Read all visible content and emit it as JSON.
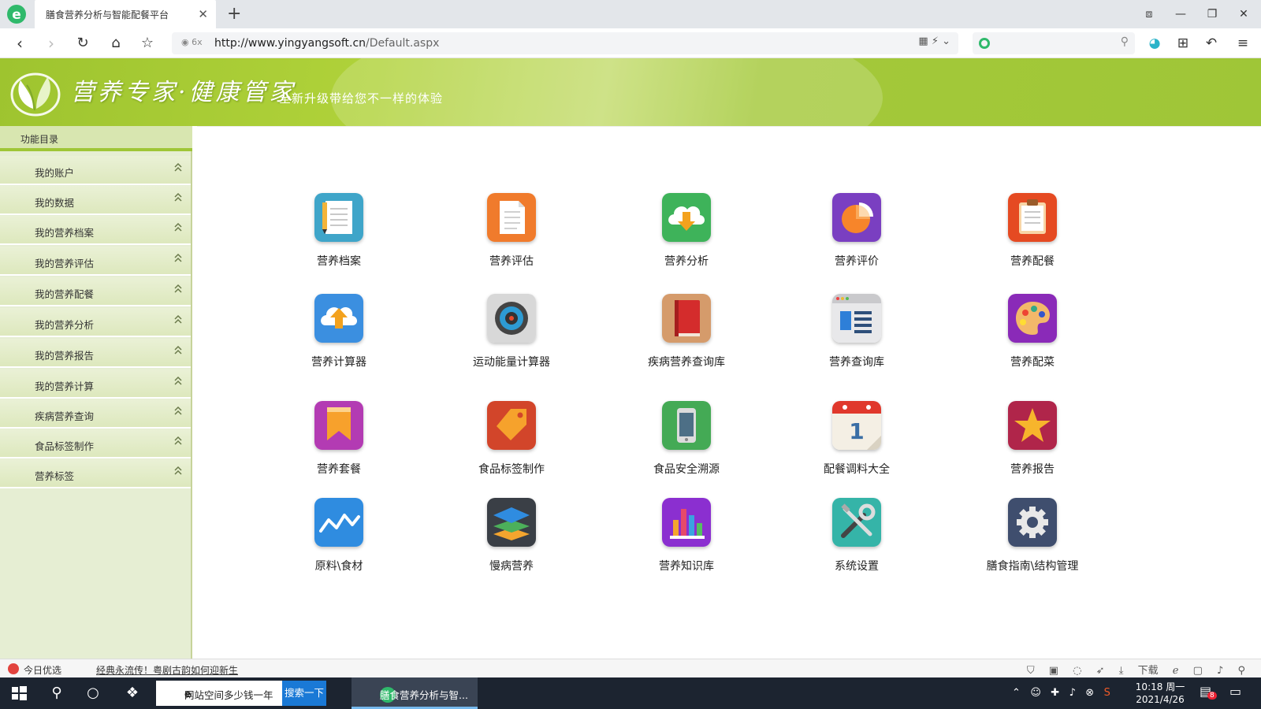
{
  "browser": {
    "tab_title": "膳食营养分析与智能配餐平台",
    "tab_close": "✕",
    "new_tab": "+",
    "url_host": "http://www.yingyangsoft.cn",
    "url_path": "/Default.aspx",
    "addr_left_icons": "◉ 6x",
    "addr_right_icons": "▦  ⚡  ⌄",
    "search_mag": "⚲"
  },
  "header": {
    "slogan": "营养专家·健康管家",
    "subslogan": "全新升级带给您不一样的体验",
    "colors": {
      "green": "#9fc637",
      "light_green": "#e6eed3"
    }
  },
  "sidebar": {
    "title": "功能目录",
    "items": [
      {
        "label": "我的账户"
      },
      {
        "label": "我的数据"
      },
      {
        "label": "我的营养档案"
      },
      {
        "label": "我的营养评估"
      },
      {
        "label": "我的营养配餐"
      },
      {
        "label": "我的营养分析"
      },
      {
        "label": "我的营养报告"
      },
      {
        "label": "我的营养计算"
      },
      {
        "label": "疾病营养查询"
      },
      {
        "label": "食品标签制作"
      },
      {
        "label": "营养标签"
      }
    ]
  },
  "apps": [
    {
      "label": "营养档案",
      "icon": "notepad-pencil-icon"
    },
    {
      "label": "营养评估",
      "icon": "document-icon"
    },
    {
      "label": "营养分析",
      "icon": "cloud-download-icon"
    },
    {
      "label": "营养评价",
      "icon": "pie-chart-icon"
    },
    {
      "label": "营养配餐",
      "icon": "clipboard-icon"
    },
    {
      "label": "营养计算器",
      "icon": "cloud-upload-icon"
    },
    {
      "label": "运动能量计算器",
      "icon": "target-icon"
    },
    {
      "label": "疾病营养查询库",
      "icon": "book-icon"
    },
    {
      "label": "营养查询库",
      "icon": "list-window-icon"
    },
    {
      "label": "营养配菜",
      "icon": "palette-icon"
    },
    {
      "label": "营养套餐",
      "icon": "bookmark-icon"
    },
    {
      "label": "食品标签制作",
      "icon": "tag-icon"
    },
    {
      "label": "食品安全溯源",
      "icon": "phone-icon"
    },
    {
      "label": "配餐调料大全",
      "icon": "calendar-icon"
    },
    {
      "label": "营养报告",
      "icon": "star-icon"
    },
    {
      "label": "原料\\食材",
      "icon": "line-chart-icon"
    },
    {
      "label": "慢病营养",
      "icon": "layers-icon"
    },
    {
      "label": "营养知识库",
      "icon": "bar-chart-icon"
    },
    {
      "label": "系统设置",
      "icon": "tools-icon"
    },
    {
      "label": "膳食指南\\结构管理",
      "icon": "gear-icon"
    }
  ],
  "statusbar": {
    "today": "今日优选",
    "news": "经典永流传！粤剧古韵如何迎新生",
    "download": "下载"
  },
  "taskbar": {
    "search_text": "网站空间多少钱一年",
    "search_button": "搜索一下",
    "active_app": "膳食营养分析与智...",
    "clock_time": "10:18 周一",
    "clock_date": "2021/4/26",
    "notify_badge": "8"
  }
}
